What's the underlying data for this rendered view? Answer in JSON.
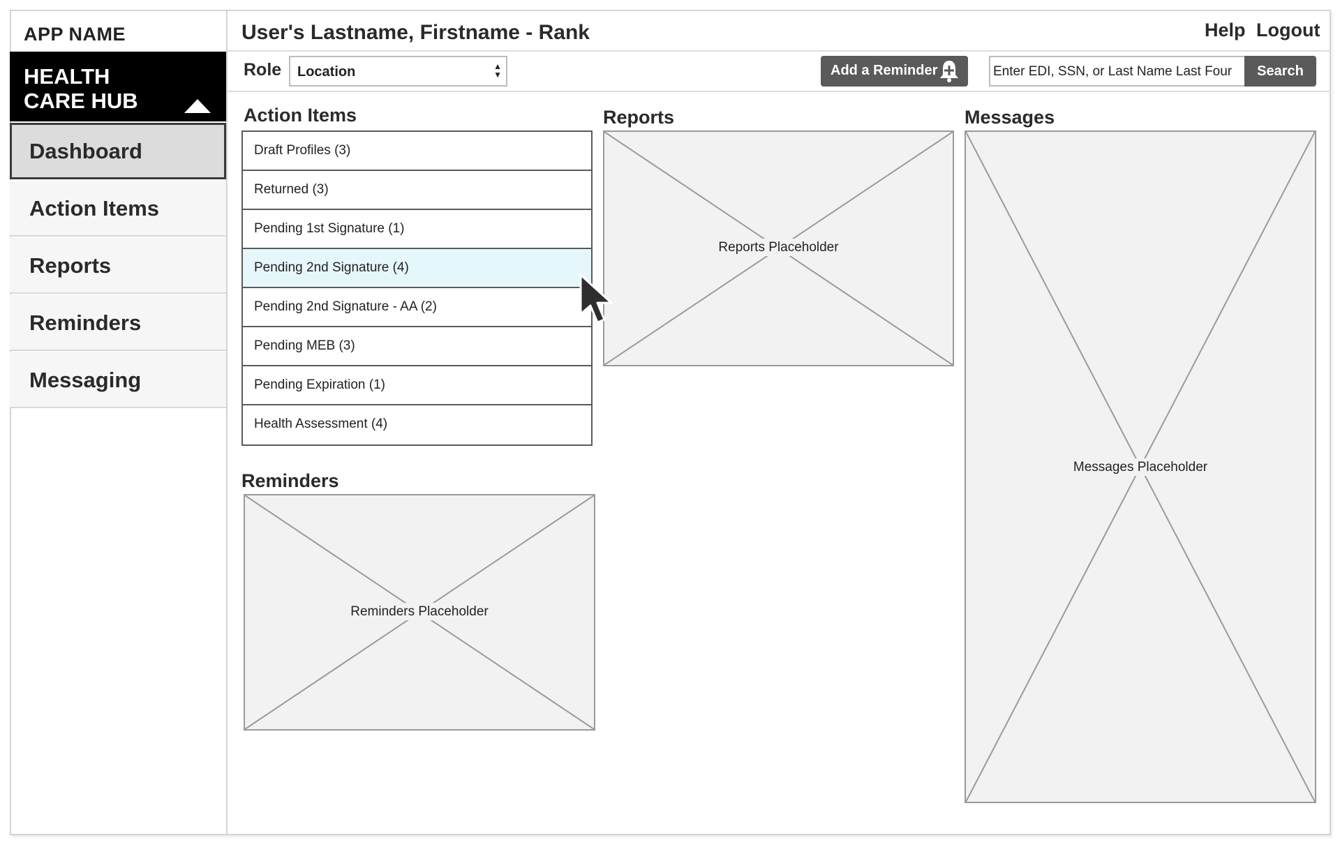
{
  "app": {
    "name": "APP NAME",
    "hub_title": "HEALTH CARE HUB"
  },
  "sidebar": {
    "items": [
      {
        "label": "Dashboard",
        "active": true
      },
      {
        "label": "Action Items"
      },
      {
        "label": "Reports"
      },
      {
        "label": "Reminders"
      },
      {
        "label": "Messaging"
      }
    ]
  },
  "header": {
    "user_title": "User's Lastname, Firstname - Rank",
    "help": "Help",
    "logout": "Logout"
  },
  "toolbar": {
    "role_label": "Role",
    "location_value": "Location",
    "add_reminder_label": "Add a Reminder",
    "search_placeholder": "Enter EDI, SSN, or Last Name Last Four",
    "search_label": "Search"
  },
  "action_items": {
    "title": "Action Items",
    "items": [
      "Draft Profiles (3)",
      "Returned (3)",
      "Pending 1st Signature (1)",
      "Pending 2nd Signature (4)",
      "Pending 2nd Signature - AA (2)",
      "Pending MEB (3)",
      "Pending Expiration (1)",
      "Health Assessment (4)"
    ],
    "hovered_index": 3
  },
  "reports": {
    "title": "Reports",
    "placeholder": "Reports Placeholder"
  },
  "reminders": {
    "title": "Reminders",
    "placeholder": "Reminders Placeholder"
  },
  "messages": {
    "title": "Messages",
    "placeholder": "Messages Placeholder"
  },
  "colors": {
    "hub_bg": "#000000",
    "active_nav_bg": "#dcdcdc",
    "button_bg": "#5a5a5a",
    "hover_row_bg": "#e6f7fb",
    "placeholder_bg": "#f2f2f2"
  }
}
